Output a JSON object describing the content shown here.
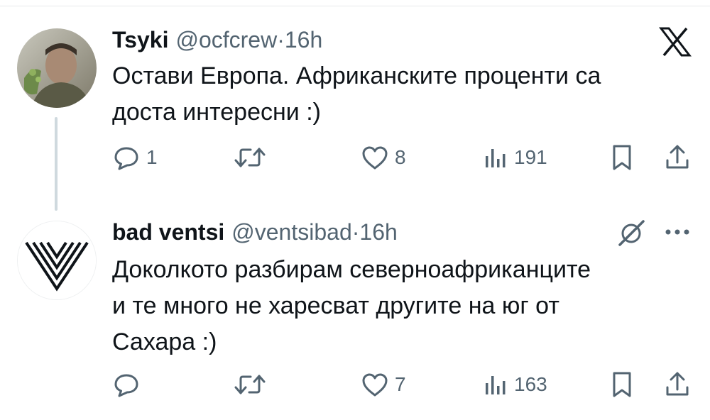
{
  "tweets": [
    {
      "name": "Tsyki",
      "handle": "@ocfcrew",
      "separator": "·",
      "time": "16h",
      "text_lines": [
        "Остави Европа. Африканските проценти са",
        "доста интересни :)"
      ],
      "counts": {
        "replies": "1",
        "retweets": "",
        "likes": "8",
        "views": "191"
      }
    },
    {
      "name": "bad ventsi",
      "handle": "@ventsibad",
      "separator": "·",
      "time": "16h",
      "text_lines": [
        "Доколкото разбирам северноафриканците",
        "и те много не харесват другите на юг от",
        "Сахара :)"
      ],
      "counts": {
        "replies": "",
        "retweets": "",
        "likes": "7",
        "views": "163"
      }
    }
  ],
  "icons": {
    "platform": "x-logo-icon",
    "actions": [
      "reply-icon",
      "retweet-icon",
      "like-icon",
      "views-icon",
      "bookmark-icon",
      "share-icon"
    ],
    "reply_header": [
      "grok-icon",
      "more-icon"
    ]
  },
  "colors": {
    "text": "#0f1419",
    "secondary": "#536471",
    "divider": "#e7e9ea",
    "thread_line": "#cfd9de"
  }
}
